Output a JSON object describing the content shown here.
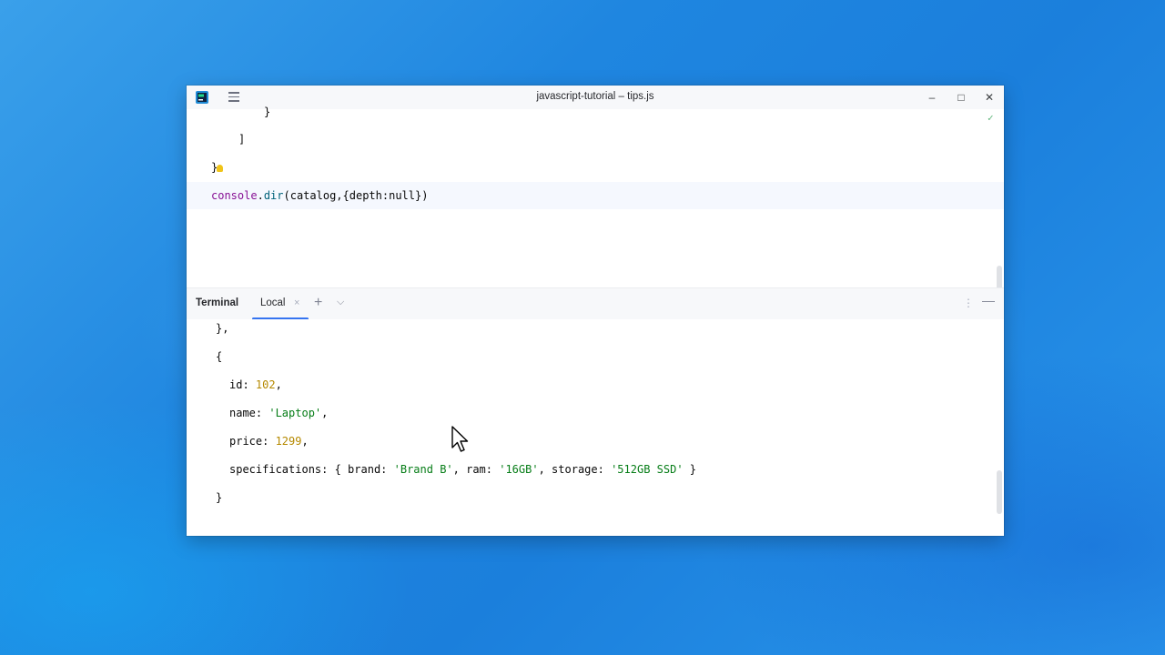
{
  "window": {
    "title": "javascript-tutorial – tips.js"
  },
  "titlebar": {
    "icons": [
      "app-logo-icon",
      "main-menu-icon",
      "minimize-icon",
      "maximize-icon",
      "close-icon"
    ],
    "minimize_glyph": "–",
    "maximize_glyph": "□",
    "close_glyph": "✕"
  },
  "editor": {
    "lines": [
      {
        "text": "}"
      },
      {
        "text": "]"
      },
      {
        "text": "}"
      },
      {
        "tokens": [
          "console",
          ".",
          "dir",
          "(catalog,{depth:null})"
        ]
      }
    ],
    "status_glyph": "✓"
  },
  "terminal": {
    "title": "Terminal",
    "tab_label": "Local",
    "tab_close": "×",
    "add_glyph": "+",
    "dropdown_glyph": "⌵",
    "more_glyph": "⋮",
    "hide_glyph": "—",
    "lines": {
      "l1": "},",
      "l2": "{",
      "id_key": "id: ",
      "id_val": "102",
      "id_end": ",",
      "name_key": "name: ",
      "name_val": "'Laptop'",
      "name_end": ",",
      "price_key": "price: ",
      "price_val": "1299",
      "price_end": ",",
      "spec_key": "specifications: { brand: ",
      "spec_brand": "'Brand B'",
      "spec_ram_key": ", ram: ",
      "spec_ram": "'16GB'",
      "spec_storage_key": ", storage: ",
      "spec_storage": "'512GB SSD'",
      "spec_end": " }",
      "l_close": "}"
    }
  },
  "colors": {
    "accent": "#3574f0",
    "string": "#067d17",
    "number": "#b58900",
    "keyword_obj": "#871094",
    "function": "#00627a"
  }
}
